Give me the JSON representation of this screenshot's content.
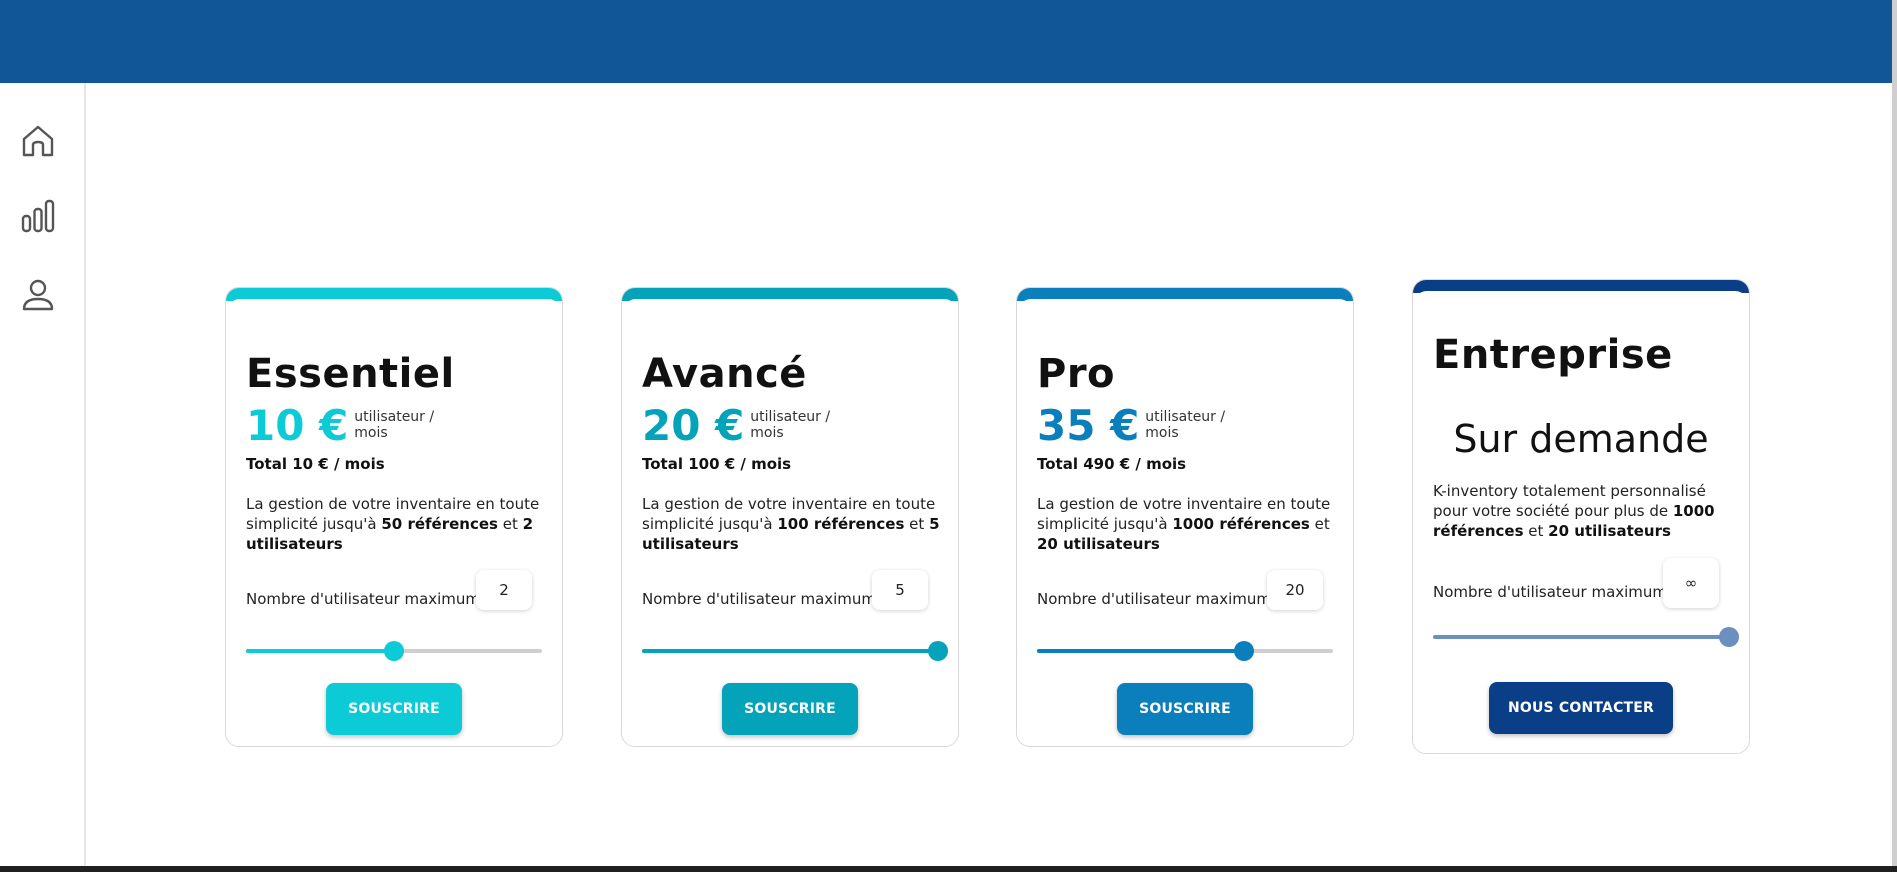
{
  "colors": {
    "topbar": "#115697",
    "essentiel": "#0ccbd6",
    "avance": "#04a3b9",
    "pro": "#0b7fbb",
    "entreprise": "#0a3f88",
    "entreprise_slider": "#6b8fbf"
  },
  "sidebar": {
    "items": [
      {
        "icon": "home-icon"
      },
      {
        "icon": "bar-chart-icon"
      },
      {
        "icon": "user-icon"
      }
    ]
  },
  "plans": [
    {
      "title": "Essentiel",
      "price": "10 €",
      "per": "utilisateur / mois",
      "total": "Total 10 € / mois",
      "desc_pre": "La gestion de votre inventaire en toute simplicité jusqu'à ",
      "desc_refs": "50 références",
      "desc_mid": " et ",
      "desc_users": "2 utilisateurs",
      "users_label": "Nombre d'utilisateur maximum",
      "users_value": "2",
      "slider_level": 0.5,
      "button": "SOUSCRIRE"
    },
    {
      "title": "Avancé",
      "price": "20 €",
      "per": "utilisateur / mois",
      "total": "Total 100 € / mois",
      "desc_pre": "La gestion de votre inventaire en toute simplicité jusqu'à ",
      "desc_refs": "100 références",
      "desc_mid": " et ",
      "desc_users": "5 utilisateurs",
      "users_label": "Nombre d'utilisateur maximum",
      "users_value": "5",
      "slider_level": 1.0,
      "button": "SOUSCRIRE"
    },
    {
      "title": "Pro",
      "price": "35 €",
      "per": "utilisateur / mois",
      "total": "Total 490 € / mois",
      "desc_pre": "La gestion de votre inventaire en toute simplicité jusqu'à ",
      "desc_refs": "1000 références",
      "desc_mid": " et ",
      "desc_users": "20 utilisateurs",
      "users_label": "Nombre d'utilisateur maximum",
      "users_value": "20",
      "slider_level": 0.7,
      "button": "SOUSCRIRE"
    }
  ],
  "enterprise": {
    "title": "Entreprise",
    "price_text": "Sur demande",
    "desc_pre": "K-inventory totalement personnalisé pour votre société pour plus de ",
    "desc_refs": "1000 références",
    "desc_mid": " et ",
    "desc_users": "20 utilisateurs",
    "users_label": "Nombre d'utilisateur maximum",
    "users_value": "∞",
    "slider_level": 1.0,
    "button": "NOUS CONTACTER"
  }
}
